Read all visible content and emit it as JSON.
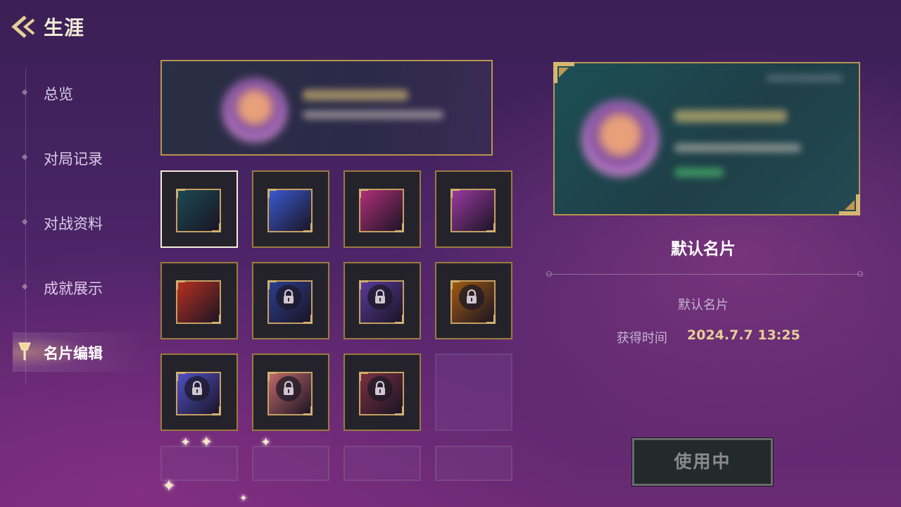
{
  "header": {
    "title": "生涯"
  },
  "sidebar": {
    "items": [
      {
        "label": "总览",
        "active": false
      },
      {
        "label": "对局记录",
        "active": false
      },
      {
        "label": "对战资料",
        "active": false
      },
      {
        "label": "成就展示",
        "active": false
      },
      {
        "label": "名片编辑",
        "active": true
      }
    ]
  },
  "grid": {
    "rows": [
      [
        {
          "state": "selected",
          "color": "#1b4a52",
          "locked": false
        },
        {
          "state": "unlocked",
          "color": "#3a5ad0",
          "locked": false
        },
        {
          "state": "unlocked",
          "color": "#b0307a",
          "locked": false
        },
        {
          "state": "unlocked",
          "color": "#9a3aa0",
          "locked": false
        }
      ],
      [
        {
          "state": "unlocked",
          "color": "#b83020",
          "locked": false
        },
        {
          "state": "locked",
          "color": "#2b3f90",
          "locked": true
        },
        {
          "state": "locked",
          "color": "#5a3a9a",
          "locked": true
        },
        {
          "state": "locked",
          "color": "#a05a10",
          "locked": true
        }
      ],
      [
        {
          "state": "locked",
          "color": "#5050c8",
          "locked": true
        },
        {
          "state": "locked",
          "color": "#c06a6a",
          "locked": true
        },
        {
          "state": "locked",
          "color": "#7a3040",
          "locked": true
        },
        {
          "state": "empty",
          "color": "",
          "locked": false
        }
      ]
    ]
  },
  "detail": {
    "title": "默认名片",
    "subtitle": "默认名片",
    "obtained_label": "获得时间",
    "obtained_value": "2024.7.7  13:25",
    "button_label": "使用中"
  },
  "colors": {
    "gold": "#b7944f",
    "accent_text": "#e6cf96"
  }
}
